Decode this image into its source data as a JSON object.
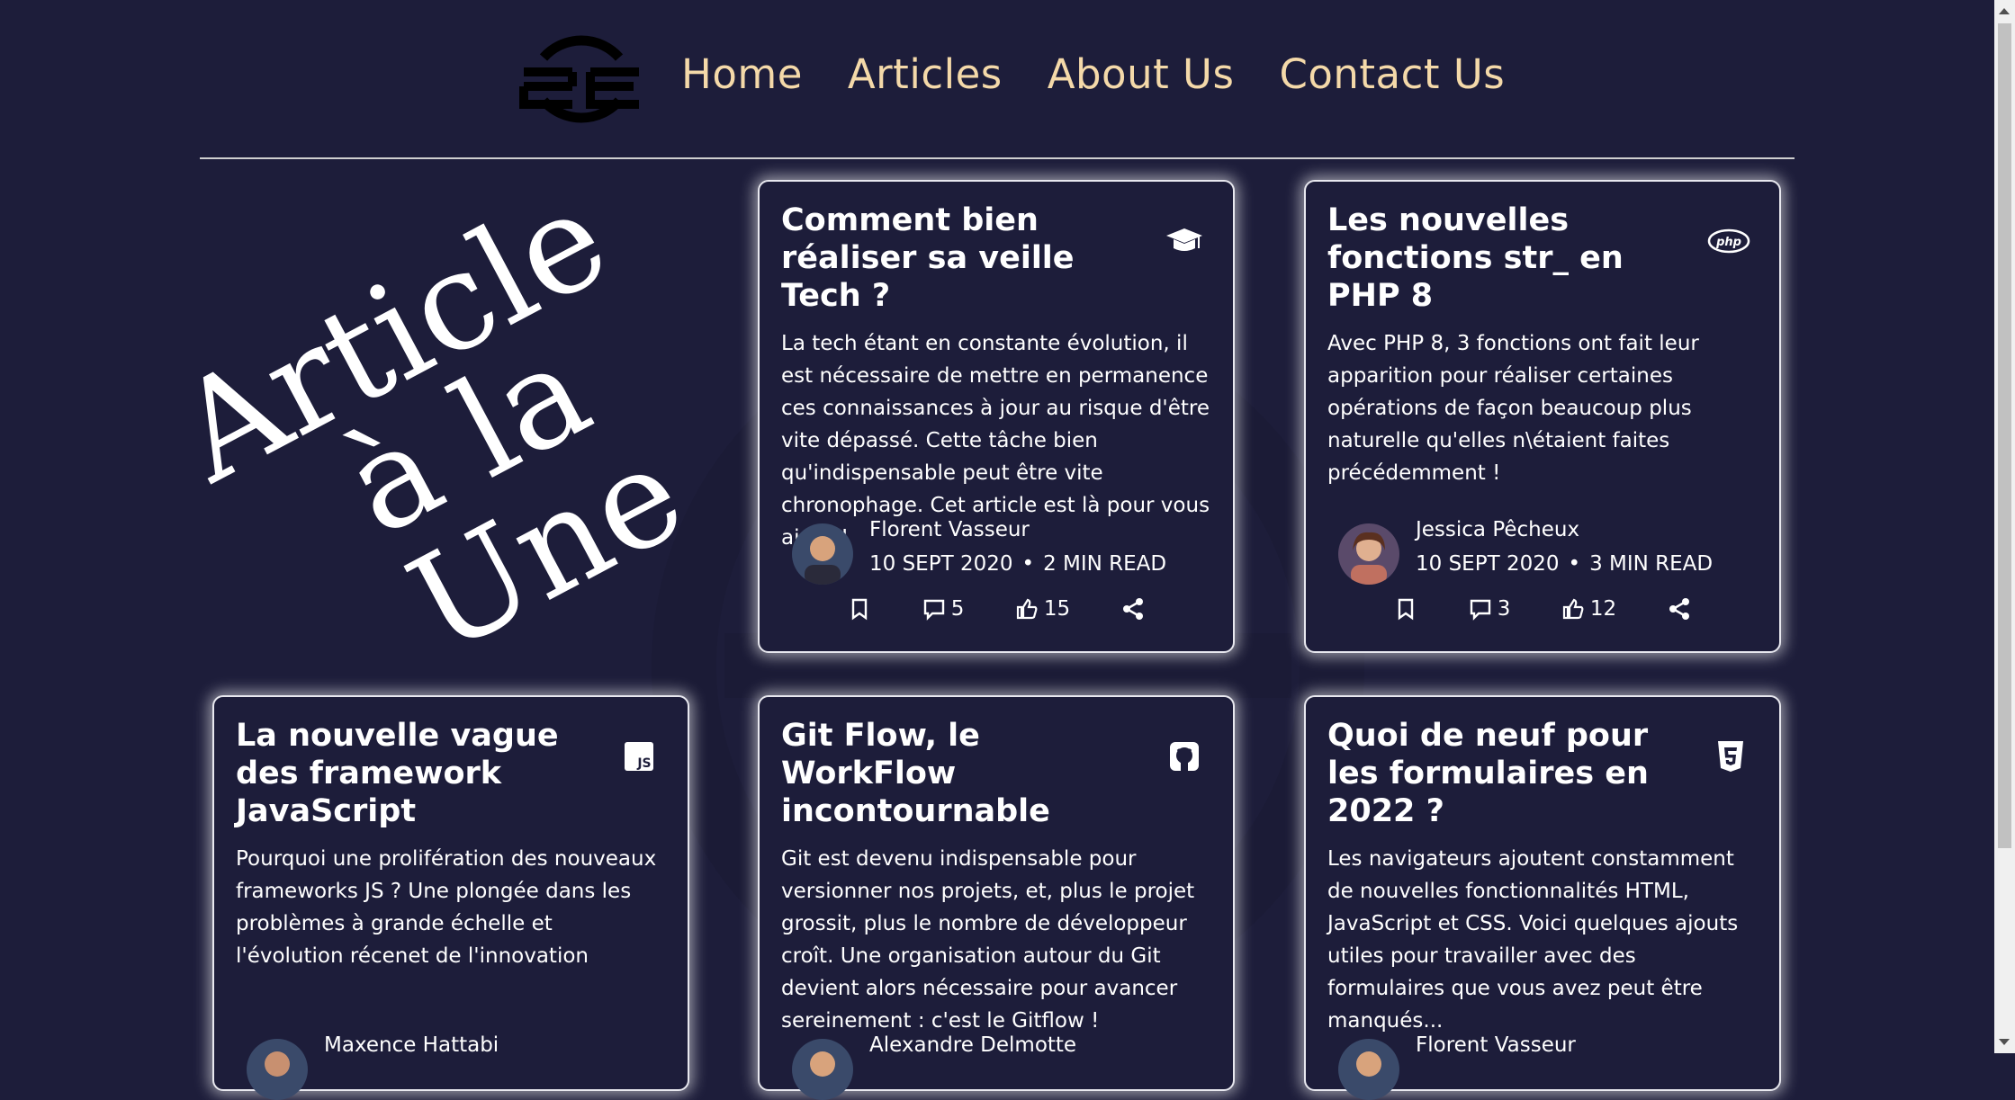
{
  "nav": {
    "logo_icon": "site-logo-icon",
    "links": [
      "Home",
      "Articles",
      "About Us",
      "Contact Us"
    ]
  },
  "hero": {
    "line1": "Article",
    "line2": "à la",
    "line3": "Une"
  },
  "cards": [
    {
      "title": "Comment bien réaliser sa veille Tech ?",
      "icon": "graduation-cap-icon",
      "description": "La tech étant en constante évolution, il est nécessaire de mettre en permanence ces connaissances à jour au risque d'être vite dépassé. Cette tâche bien qu'indispensable peut être vite chronophage. Cet article est là pour vous aider !",
      "author": "Florent Vasseur",
      "date": "10 SEPT 2020",
      "read_time": "2 MIN READ",
      "comments": "5",
      "likes": "15"
    },
    {
      "title": "Les nouvelles fonctions str_ en PHP 8",
      "icon": "php-icon",
      "description": "Avec PHP 8, 3 fonctions ont fait leur apparition pour réaliser certaines opérations de façon beaucoup plus naturelle qu'elles n\\étaient faites précédemment !",
      "author": "Jessica Pêcheux",
      "date": "10 SEPT 2020",
      "read_time": "3 MIN READ",
      "comments": "3",
      "likes": "12"
    },
    {
      "title": "La nouvelle vague des framework JavaScript",
      "icon": "javascript-icon",
      "description": "Pourquoi une prolifération des nouveaux frameworks JS ? Une plongée dans les problèmes à grande échelle et l'évolution récenet de l'innovation",
      "author": "Maxence Hattabi"
    },
    {
      "title": "Git Flow, le WorkFlow incontournable",
      "icon": "github-icon",
      "description": "Git est devenu indispensable pour versionner nos projets, et, plus le projet grossit, plus le nombre de développeur croît. Une organisation autour du Git devient alors nécessaire pour avancer sereinement : c'est le Gitflow !",
      "author": "Alexandre Delmotte"
    },
    {
      "title": "Quoi de neuf pour les formulaires en 2022 ?",
      "icon": "html5-icon",
      "description": "Les navigateurs ajoutent constamment de nouvelles fonctionnalités HTML, JavaScript et CSS. Voici quelques ajouts utiles pour travailler avec des formulaires que vous avez peut être manqués...",
      "author": "Florent Vasseur"
    }
  ],
  "colors": {
    "background": "#1d1d3a",
    "nav_link": "#f4d9a9",
    "text": "#ffffff"
  }
}
